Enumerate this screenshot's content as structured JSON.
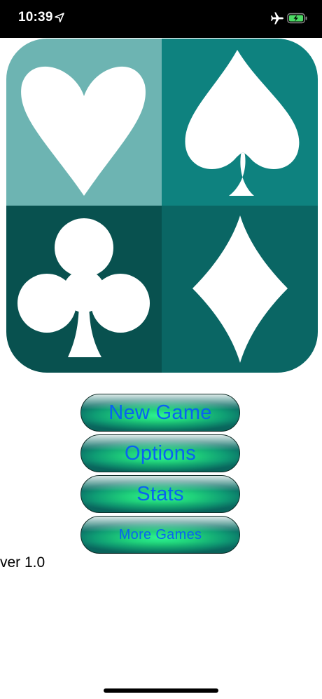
{
  "status_bar": {
    "time": "10:39",
    "icons": [
      "location-arrow-icon",
      "airplane-icon",
      "battery-charging-icon"
    ],
    "battery_color": "#4cd964"
  },
  "logo": {
    "suits": [
      "heart",
      "spade",
      "club",
      "diamond"
    ],
    "colors": {
      "heart_bg": "#6db4b2",
      "spade_bg": "#0e827f",
      "club_bg": "#08514f",
      "diamond_bg": "#0a6664",
      "suit_fill": "#ffffff"
    }
  },
  "menu": {
    "new_game": "New Game",
    "options": "Options",
    "stats": "Stats",
    "more_games": "More Games",
    "text_color": "#0a62f0"
  },
  "version": "ver 1.0"
}
